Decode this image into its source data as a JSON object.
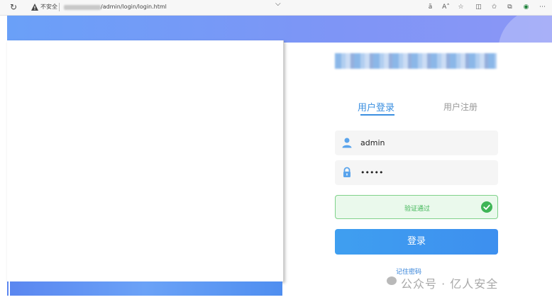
{
  "browser": {
    "security_label": "不安全",
    "url": "/admin/login/login.html"
  },
  "login": {
    "tabs": [
      {
        "label": "用户登录"
      },
      {
        "label": "用户注册"
      }
    ],
    "username_value": "admin",
    "password_value": "•••••",
    "captcha_status": "验证通过",
    "submit_label": "登录",
    "remember_label": "记住密码"
  },
  "watermark": {
    "text": "公众号 · 亿人安全"
  },
  "colors": {
    "accent": "#3b8fe0",
    "success": "#3fb556",
    "banner": "#7e95f6"
  }
}
